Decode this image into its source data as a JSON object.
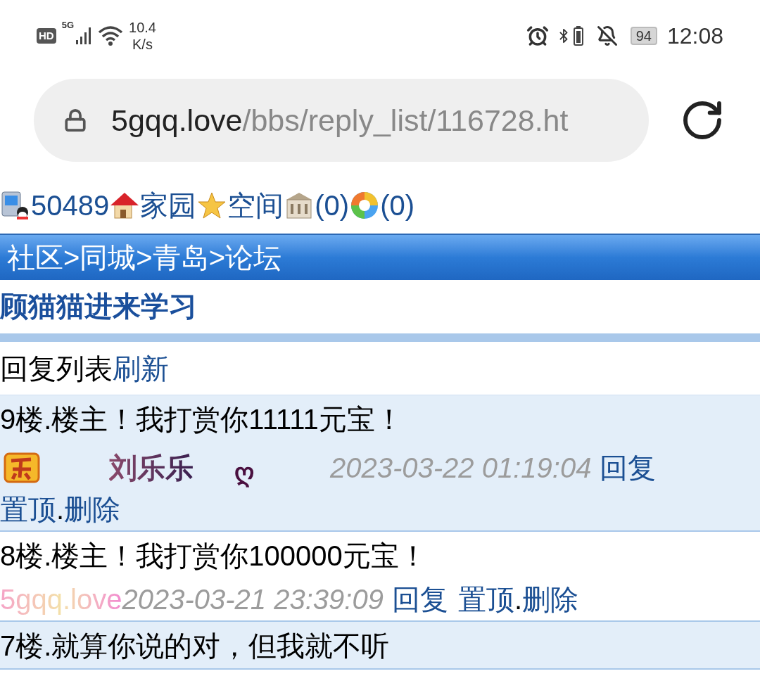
{
  "status_bar": {
    "hd": "HD",
    "network": "5G",
    "speed": "10.4",
    "speed_unit": "K/s",
    "battery": "94",
    "time": "12:08"
  },
  "address_bar": {
    "domain": "5gqq.love",
    "path": "/bbs/reply_list/116728.ht"
  },
  "nav": [
    "50489",
    "家园",
    "空间",
    "(0)",
    "(0)"
  ],
  "breadcrumb": "社区>同城>青岛>论坛",
  "title": "顾猫猫进来学习",
  "list_header": {
    "label": "回复列表",
    "refresh": "刷新"
  },
  "replies": [
    {
      "highlighted": true,
      "text": "9楼.楼主！我打赏你11111元宝！",
      "author": {
        "kind": "badge",
        "name": "刘乐乐",
        "mark": "ღ"
      },
      "time": "2023-03-22 01:19:04",
      "reply": "回复",
      "pin": "置顶",
      "sep": ".",
      "delete": "删除"
    },
    {
      "highlighted": false,
      "text": "8楼.楼主！我打赏你100000元宝！",
      "author": {
        "kind": "rainbow",
        "name": "5gqq.love"
      },
      "time": "2023-03-21 23:39:09",
      "reply": "回复",
      "pin": "置顶",
      "sep": ".",
      "delete": "删除"
    },
    {
      "highlighted": true,
      "text": "7楼.就算你说的对，但我就不听"
    }
  ]
}
